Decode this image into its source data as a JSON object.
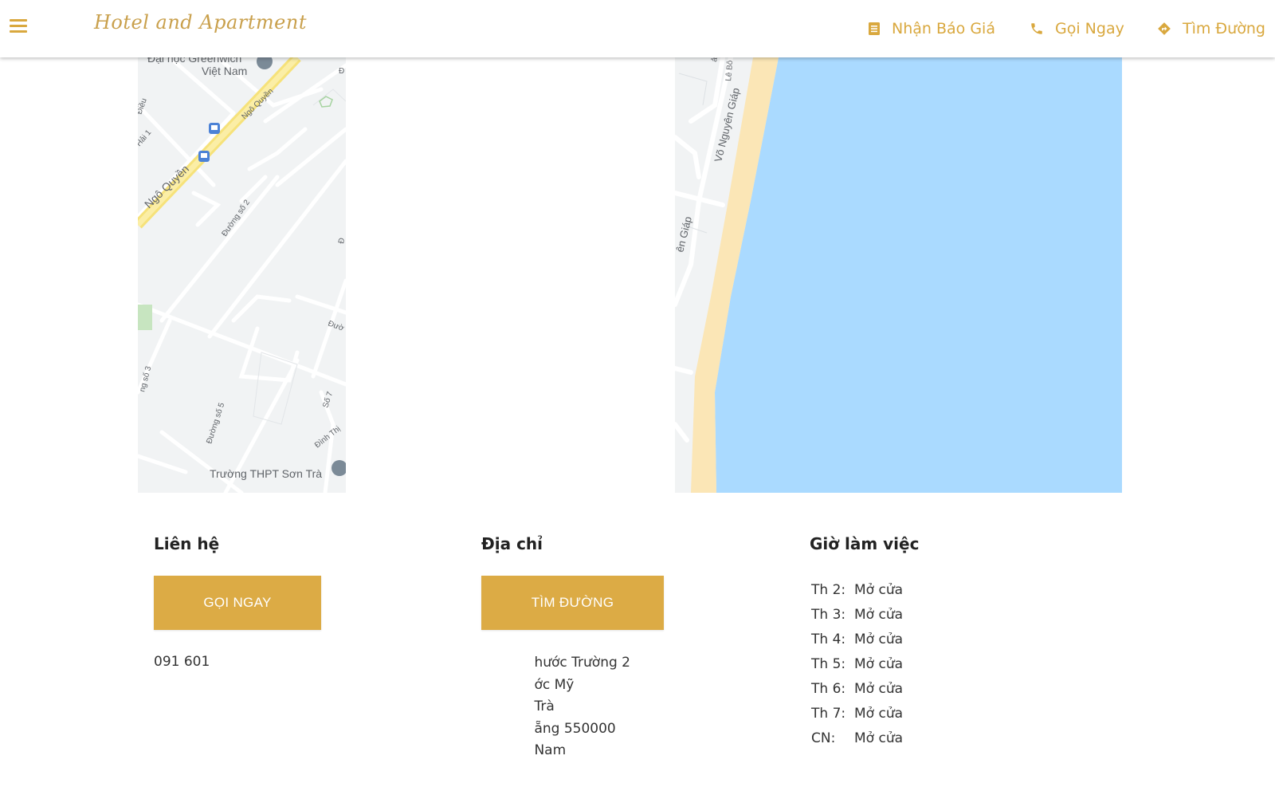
{
  "header": {
    "brand": "Hotel and Apartment",
    "nav": {
      "quote": "Nhận Báo Giá",
      "call": "Gọi Ngay",
      "directions": "Tìm Đường"
    },
    "accent_color": "#d9a83e"
  },
  "map_left": {
    "labels": {
      "university": "Đại học Greenwich",
      "university_country": "Việt Nam",
      "street_ngo_quyen": "Ngô Quyền",
      "street_ngo_quyen_small": "Ngô Quyền",
      "duong_so_2": "Đường số 2",
      "duong_so_3": "ng số 3",
      "duong_so_5": "Đường số 5",
      "duong_so_7": "Số 7",
      "dieu": "Điều",
      "hai1": "Hải 1",
      "duong_edge": "Đườ",
      "dinh_thi": "Đình Thị",
      "school": "Trường THPT Sơn Trà",
      "d_edge": "Đ",
      "d_edge2": "Đ"
    }
  },
  "map_right": {
    "labels": {
      "vo_nguyen_giap": "Võ Nguyên Giáp",
      "vo_nguyen_giap_cut": "ên Giáp",
      "le_bo": "Lê Bô",
      "so": "ả"
    }
  },
  "contact": {
    "title": "Liên hệ",
    "button": "GỌI NGAY",
    "phone": "091 601"
  },
  "address": {
    "title": "Địa chỉ",
    "button": "TÌM ĐƯỜNG",
    "lines": [
      "hước Trường 2",
      "ớc Mỹ",
      "Trà",
      "ẵng 550000",
      "Nam"
    ]
  },
  "hours": {
    "title": "Giờ làm việc",
    "rows": [
      {
        "day": "Th 2:",
        "status": "Mở cửa"
      },
      {
        "day": "Th 3:",
        "status": "Mở cửa"
      },
      {
        "day": "Th 4:",
        "status": "Mở cửa"
      },
      {
        "day": "Th 5:",
        "status": "Mở cửa"
      },
      {
        "day": "Th 6:",
        "status": "Mở cửa"
      },
      {
        "day": "Th 7:",
        "status": "Mở cửa"
      },
      {
        "day": "CN:",
        "status": "Mở cửa"
      }
    ]
  }
}
